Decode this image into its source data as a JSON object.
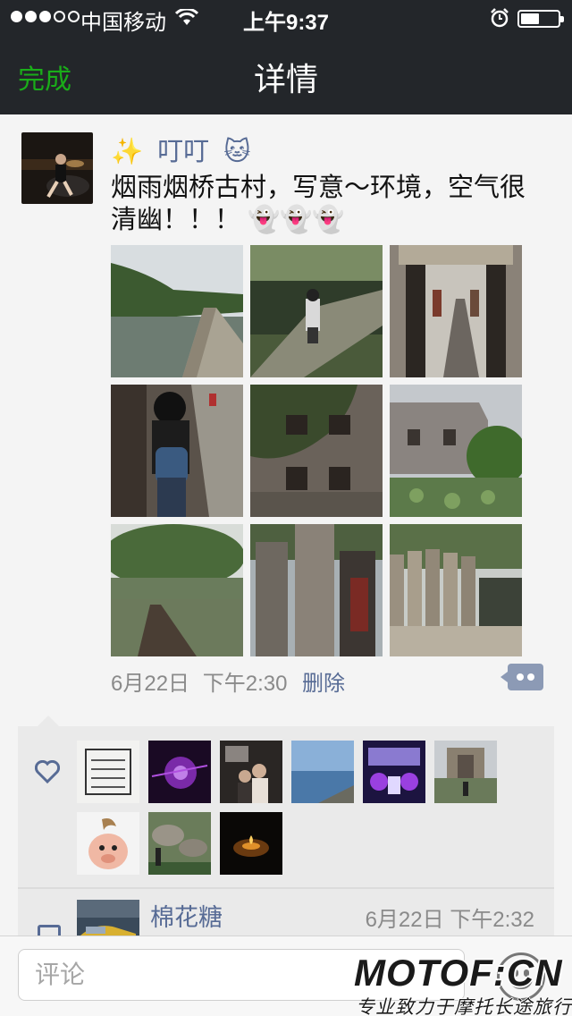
{
  "status_bar": {
    "carrier": "中国移动",
    "time": "上午9:37",
    "signal_filled": 3,
    "signal_total": 5,
    "battery_level": 0.45
  },
  "nav": {
    "done_label": "完成",
    "title": "详情"
  },
  "post": {
    "author_prefix": "✨",
    "author": "叮叮",
    "author_suffix": "🐱",
    "text": "烟雨烟桥古村，写意～环境，空气很清幽！！！ 👻👻👻",
    "date": "6月22日",
    "time": "下午2:30",
    "delete_label": "删除",
    "photos": [
      {
        "name": "river-canal"
      },
      {
        "name": "motorbike-path"
      },
      {
        "name": "stone-gate-alley"
      },
      {
        "name": "girl-backpack-alley"
      },
      {
        "name": "ivy-brick-wall"
      },
      {
        "name": "old-house-lotus"
      },
      {
        "name": "banyan-pier"
      },
      {
        "name": "stone-steles"
      },
      {
        "name": "stele-row-bridge"
      }
    ]
  },
  "likes": {
    "icon": "heart-icon",
    "avatars": [
      "sketch",
      "purple-orb",
      "poster-couple",
      "sea-view",
      "neon-hall",
      "building-plaza",
      "cartoon-pig",
      "rock-garden",
      "candle-dark"
    ]
  },
  "comment": {
    "name": "棉花糖",
    "time": "6月22日 下午2:32"
  },
  "input": {
    "placeholder": "评论"
  },
  "watermark": {
    "brand": "MOTOF:CN",
    "slogan": "专业致力于摩托长途旅行"
  },
  "colors": {
    "accent_green": "#1aad19",
    "link_blue": "#576b95",
    "nav_bg": "#23262a"
  }
}
